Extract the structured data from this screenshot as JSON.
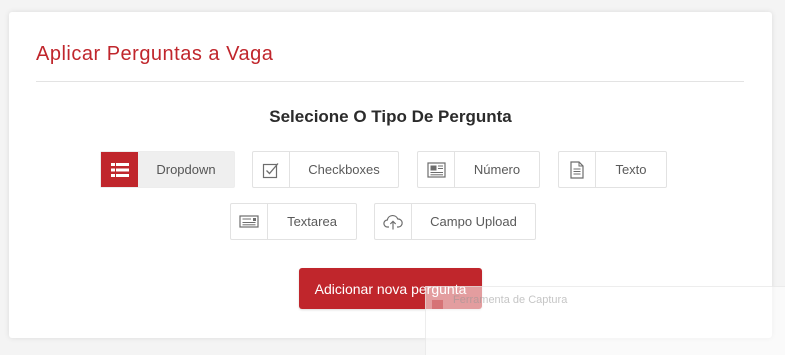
{
  "header": {
    "title": "Aplicar Perguntas a Vaga"
  },
  "selector": {
    "heading": "Selecione O Tipo De Pergunta",
    "selected": "Dropdown",
    "options": [
      {
        "label": "Dropdown",
        "icon": "list-icon"
      },
      {
        "label": "Checkboxes",
        "icon": "checkbox-icon"
      },
      {
        "label": "Número",
        "icon": "number-icon"
      },
      {
        "label": "Texto",
        "icon": "text-document-icon"
      },
      {
        "label": "Textarea",
        "icon": "textarea-icon"
      },
      {
        "label": "Campo Upload",
        "icon": "cloud-upload-icon"
      }
    ]
  },
  "actions": {
    "add_label": "Adicionar nova pergunta"
  },
  "capture_tool": {
    "label": "Ferramenta de Captura"
  },
  "colors": {
    "accent": "#c0262c",
    "background": "#f4f4f4",
    "card": "#ffffff",
    "selected_bg": "#efefef"
  }
}
